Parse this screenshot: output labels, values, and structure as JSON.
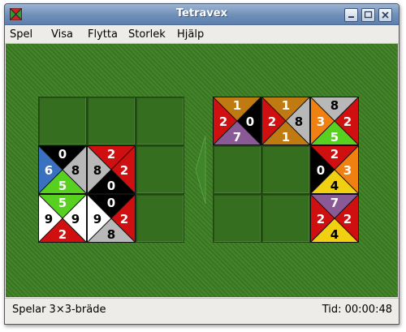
{
  "window": {
    "title": "Tetravex"
  },
  "menu": [
    {
      "label": "Spel",
      "name": "menu-spel"
    },
    {
      "label": "Visa",
      "name": "menu-visa"
    },
    {
      "label": "Flytta",
      "name": "menu-flytta"
    },
    {
      "label": "Storlek",
      "name": "menu-storlek"
    },
    {
      "label": "Hjälp",
      "name": "menu-hjalp"
    }
  ],
  "status": {
    "message": "Spelar 3×3-bräde",
    "timer": "Tid: 00:00:48"
  },
  "colors": {
    "0": "#000000",
    "1": "#c07a12",
    "2": "#d01010",
    "3": "#f08010",
    "4": "#f0d010",
    "5": "#58d020",
    "6": "#3a70c0",
    "7": "#8a5a96",
    "8": "#b8b8b8",
    "9": "#ffffff"
  },
  "boards": {
    "left": {
      "name": "solution-board",
      "tiles": [
        {
          "row": 1,
          "col": 0,
          "n": "0",
          "e": "8",
          "s": "5",
          "w": "6"
        },
        {
          "row": 1,
          "col": 1,
          "n": "2",
          "e": "2",
          "s": "0",
          "w": "8"
        },
        {
          "row": 2,
          "col": 0,
          "n": "5",
          "e": "9",
          "s": "2",
          "w": "9"
        },
        {
          "row": 2,
          "col": 1,
          "n": "0",
          "e": "2",
          "s": "8",
          "w": "9"
        }
      ]
    },
    "right": {
      "name": "pieces-board",
      "tiles": [
        {
          "row": 0,
          "col": 0,
          "n": "1",
          "e": "0",
          "s": "7",
          "w": "2"
        },
        {
          "row": 0,
          "col": 1,
          "n": "1",
          "e": "8",
          "s": "1",
          "w": "2"
        },
        {
          "row": 0,
          "col": 2,
          "n": "8",
          "e": "2",
          "s": "5",
          "w": "3"
        },
        {
          "row": 1,
          "col": 2,
          "n": "2",
          "e": "3",
          "s": "4",
          "w": "0"
        },
        {
          "row": 2,
          "col": 2,
          "n": "7",
          "e": "2",
          "s": "4",
          "w": "2"
        }
      ]
    }
  }
}
